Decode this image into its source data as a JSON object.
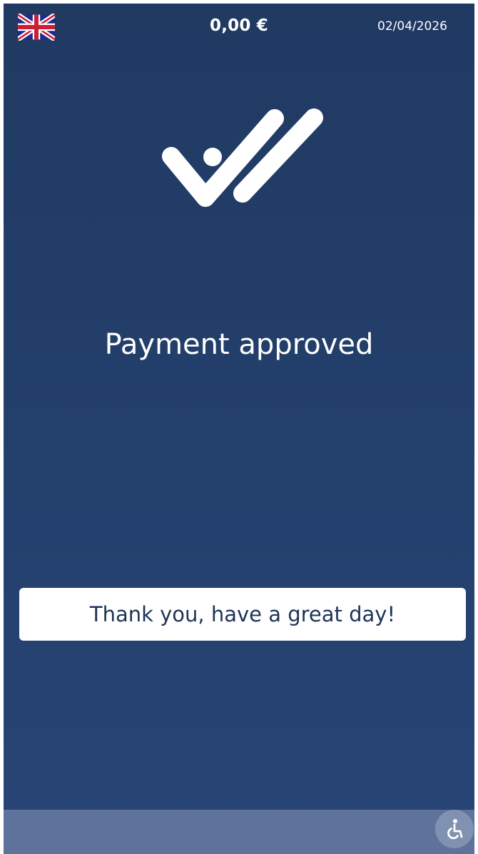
{
  "header": {
    "language_icon": "uk-flag-icon",
    "amount": "0,00 €",
    "date": "02/04/2026"
  },
  "status": {
    "icon": "double-check-icon",
    "title": "Payment approved"
  },
  "message": {
    "text": "Thank you, have a great day!"
  },
  "footer": {
    "accessibility_icon": "wheelchair-icon"
  },
  "colors": {
    "background_top": "#203a62",
    "background_bottom": "#284577",
    "text_primary": "#ffffff",
    "message_text": "#1e3457",
    "bottom_bar": "#5e729c"
  }
}
